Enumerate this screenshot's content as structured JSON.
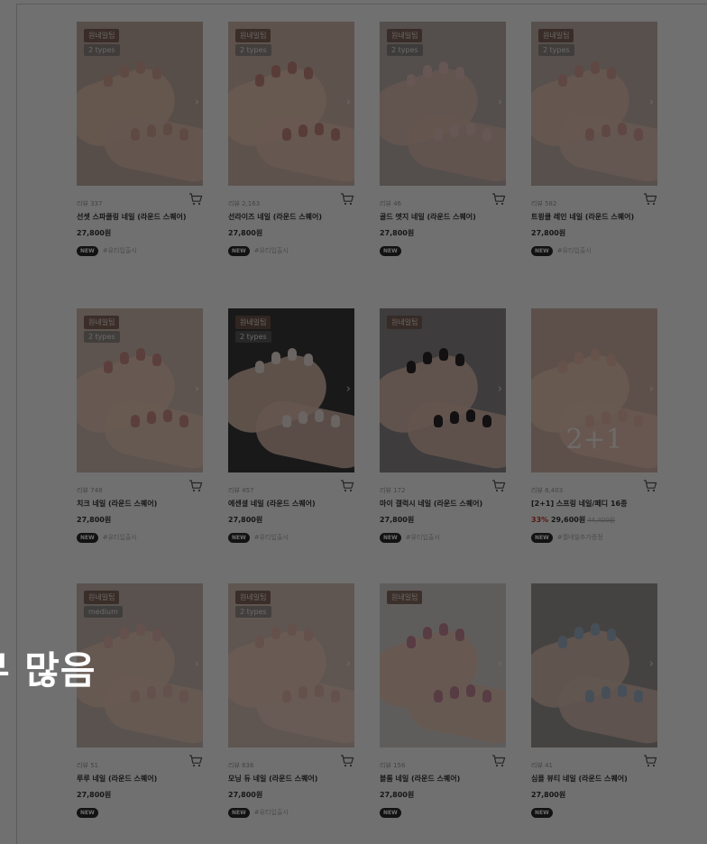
{
  "overlay": {
    "message": "무 많음"
  },
  "products": [
    {
      "review": "리뷰 337",
      "name": "선셋 스파클링 네일 (라운드 스퀘어)",
      "price": "27,800원",
      "discount": "",
      "old_price": "",
      "new": "NEW",
      "tag": "#유티입출시",
      "top_badge": "원네일팁",
      "types_badge": "2 types",
      "promo": "",
      "bg": "#c9b2a6",
      "skin": "#e8c6b4",
      "nail": "#d9a79a"
    },
    {
      "review": "리뷰 2,163",
      "name": "선라이즈 네일 (라운드 스퀘어)",
      "price": "27,800원",
      "discount": "",
      "old_price": "",
      "new": "NEW",
      "tag": "#유티입출시",
      "top_badge": "원네일팁",
      "types_badge": "2 types",
      "promo": "",
      "bg": "#d7bcb0",
      "skin": "#ecc9b8",
      "nail": "#c98a80"
    },
    {
      "review": "리뷰 46",
      "name": "골드 엣지 네일 (라운드 스퀘어)",
      "price": "27,800원",
      "discount": "",
      "old_price": "",
      "new": "NEW",
      "tag": "",
      "top_badge": "원네일팁",
      "types_badge": "2 types",
      "promo": "",
      "bg": "#bfb1ad",
      "skin": "#e3c2b5",
      "nail": "#e8c7c0"
    },
    {
      "review": "리뷰 582",
      "name": "트윙클 레인 네일 (라운드 스퀘어)",
      "price": "27,800원",
      "discount": "",
      "old_price": "",
      "new": "NEW",
      "tag": "#유티입출시",
      "top_badge": "원네일팁",
      "types_badge": "2 types",
      "promo": "",
      "bg": "#c7b6ad",
      "skin": "#e9c7b7",
      "nail": "#d8a59c"
    },
    {
      "review": "리뷰 748",
      "name": "치크 네일 (라운드 스퀘어)",
      "price": "27,800원",
      "discount": "",
      "old_price": "",
      "new": "NEW",
      "tag": "#유티입출시",
      "top_badge": "원네일팁",
      "types_badge": "2 types",
      "promo": "",
      "bg": "#d3bfb3",
      "skin": "#eccbb9",
      "nail": "#cf8f8a"
    },
    {
      "review": "리뷰 457",
      "name": "에센셜 네일 (라운드 스퀘어)",
      "price": "27,800원",
      "discount": "",
      "old_price": "",
      "new": "NEW",
      "tag": "#유티입출시",
      "top_badge": "원네일팁",
      "types_badge": "2 types",
      "promo": "",
      "bg": "#3b3a3a",
      "skin": "#e6c6b6",
      "nail": "#f1e5df"
    },
    {
      "review": "리뷰 172",
      "name": "마이 갤럭시 네일 (라운드 스퀘어)",
      "price": "27,800원",
      "discount": "",
      "old_price": "",
      "new": "NEW",
      "tag": "#유티입출시",
      "top_badge": "원네일팁",
      "types_badge": "",
      "promo": "",
      "bg": "#8d8a8c",
      "skin": "#e2c1b1",
      "nail": "#2b2527"
    },
    {
      "review": "리뷰 8,403",
      "name": "[2+1] 스프링 네일/페디 16종",
      "price": "29,600원",
      "discount": "33%",
      "old_price": "44,400원",
      "new": "NEW",
      "tag": "#젤네일추가증정",
      "top_badge": "",
      "types_badge": "",
      "promo": "2+1",
      "bg": "#d4b7a8",
      "skin": "#edcab8",
      "nail": "#e8b8ab"
    },
    {
      "review": "리뷰 51",
      "name": "루루 네일 (라운드 스퀘어)",
      "price": "27,800원",
      "discount": "",
      "old_price": "",
      "new": "NEW",
      "tag": "",
      "top_badge": "원네일팁",
      "types_badge": "medium",
      "promo": "",
      "bg": "#cbbcb4",
      "skin": "#ecccbd",
      "nail": "#e4b7ad"
    },
    {
      "review": "리뷰 636",
      "name": "모닝 듀 네일 (라운드 스퀘어)",
      "price": "27,800원",
      "discount": "",
      "old_price": "",
      "new": "NEW",
      "tag": "#유티입출시",
      "top_badge": "원네일팁",
      "types_badge": "2 types",
      "promo": "",
      "bg": "#d9c3b8",
      "skin": "#efd0c0",
      "nail": "#e7b8ae"
    },
    {
      "review": "리뷰 156",
      "name": "블룸 네일 (라운드 스퀘어)",
      "price": "27,800원",
      "discount": "",
      "old_price": "",
      "new": "NEW",
      "tag": "",
      "top_badge": "원네일팁",
      "types_badge": "",
      "promo": "",
      "bg": "#d9d4d1",
      "skin": "#ebc9b9",
      "nail": "#c98a9a"
    },
    {
      "review": "리뷰 41",
      "name": "심플 뷰티 네일 (라운드 스퀘어)",
      "price": "27,800원",
      "discount": "",
      "old_price": "",
      "new": "NEW",
      "tag": "",
      "top_badge": "",
      "types_badge": "",
      "promo": "",
      "bg": "#9d9896",
      "skin": "#e1c4b6",
      "nail": "#9fb5c9"
    }
  ]
}
